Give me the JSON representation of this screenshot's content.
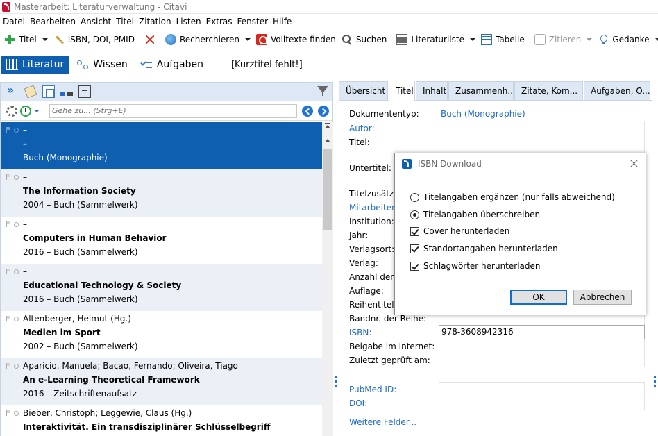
{
  "window": {
    "title": "Masterarbeit: Literaturverwaltung - Citavi"
  },
  "menu": [
    "Datei",
    "Bearbeiten",
    "Ansicht",
    "Titel",
    "Zitation",
    "Listen",
    "Extras",
    "Fenster",
    "Hilfe"
  ],
  "toolbar": {
    "add_title": "Titel",
    "isbn_doi": "ISBN, DOI, PMID",
    "research": "Recherchieren",
    "fulltext": "Volltexte finden",
    "search": "Suchen",
    "reference_list": "Literaturliste",
    "table": "Tabelle",
    "cite": "Zitieren",
    "idea": "Gedanke"
  },
  "modules": {
    "literature": "Literatur",
    "knowledge": "Wissen",
    "tasks": "Aufgaben",
    "short_title": "[Kurztitel fehlt!]"
  },
  "left": {
    "search_placeholder": "Gehe zu... (Strg+E)",
    "references": [
      {
        "line1": "–",
        "line2": "–",
        "line3": "Buch (Monographie)"
      },
      {
        "line1": "–",
        "line2": "The Information Society",
        "line3": "2004 – Buch (Sammelwerk)"
      },
      {
        "line1": "–",
        "line2": "Computers in Human Behavior",
        "line3": "2016 – Buch (Sammelwerk)"
      },
      {
        "line1": "–",
        "line2": "Educational Technology & Society",
        "line3": "2016 – Buch (Sammelwerk)"
      },
      {
        "line1": "Altenberger, Helmut (Hg.)",
        "line2": "Medien im Sport",
        "line3": "2002 – Buch (Sammelwerk)"
      },
      {
        "line1": "Aparicio, Manuela; Bacao, Fernando; Oliveira, Tiago",
        "line2": "An e-Learning Theoretical Framework",
        "line3": "2016 – Zeitschriftenaufsatz"
      },
      {
        "line1": "Bieber, Christoph; Leggewie, Claus (Hg.)",
        "line2": "Interaktivität. Ein transdisziplinärer Schlüsselbegriff",
        "line3": ""
      }
    ]
  },
  "right": {
    "tabs": [
      "Übersicht",
      "Titel",
      "Inhalt",
      "Zusammenh...",
      "Zitate, Kom...",
      "Aufgaben, O..."
    ],
    "fields": {
      "doctype_label": "Dokumententyp:",
      "doctype_value": "Buch (Monographie)",
      "author": "Autor:",
      "title": "Titel:",
      "subtitle": "Untertitel:",
      "title_suffix": "Titelzusätze:",
      "contributors": "Mitarbeiter:",
      "institution": "Institution:",
      "year": "Jahr:",
      "place": "Verlagsort:",
      "publisher": "Verlag:",
      "volumes": "Anzahl der B",
      "edition": "Auflage:",
      "series": "Reihentitel:",
      "series_no": "Bandnr. der Reihe:",
      "isbn": "ISBN:",
      "isbn_value": "978-3608942316",
      "online": "Beigabe im Internet:",
      "checked": "Zuletzt geprüft am:",
      "pubmed": "PubMed ID:",
      "doi": "DOI:",
      "more": "Weitere Felder..."
    }
  },
  "dialog": {
    "title": "ISBN Download",
    "options": [
      {
        "label": "Titelangaben ergänzen (nur falls abweichend)",
        "type": "radio",
        "checked": false
      },
      {
        "label": "Titelangaben überschreiben",
        "type": "radio",
        "checked": true
      },
      {
        "label": "Cover herunterladen",
        "type": "checkbox",
        "checked": true
      },
      {
        "label": "Standortangaben herunterladen",
        "type": "checkbox",
        "checked": true
      },
      {
        "label": "Schlagwörter herunterladen",
        "type": "checkbox",
        "checked": true
      }
    ],
    "ok": "OK",
    "cancel": "Abbrechen"
  }
}
